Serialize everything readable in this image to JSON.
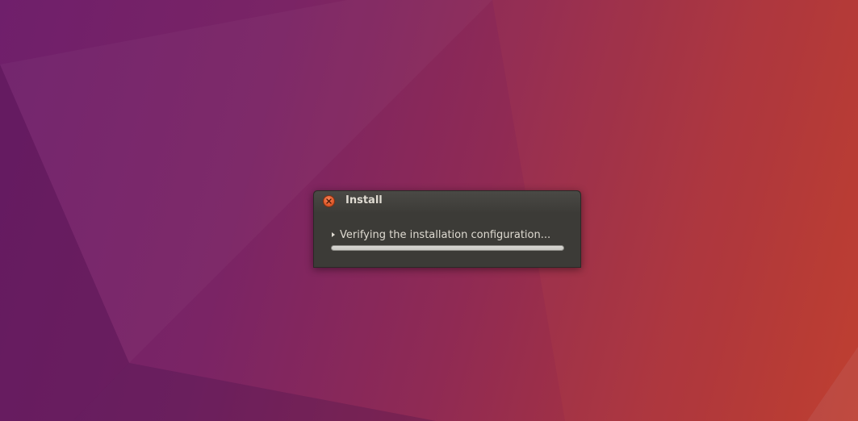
{
  "dialog": {
    "title": "Install",
    "status_text": "Verifying the installation configuration...",
    "progress_fraction": 0.0
  },
  "colors": {
    "wallpaper_left": "#6f1f6b",
    "wallpaper_right": "#bb3c2f",
    "dialog_bg": "#3c3b37",
    "close_button": "#e05a2a",
    "text": "#dfdbd2"
  },
  "icons": {
    "close": "close-icon",
    "expander": "expander-arrow-icon"
  }
}
